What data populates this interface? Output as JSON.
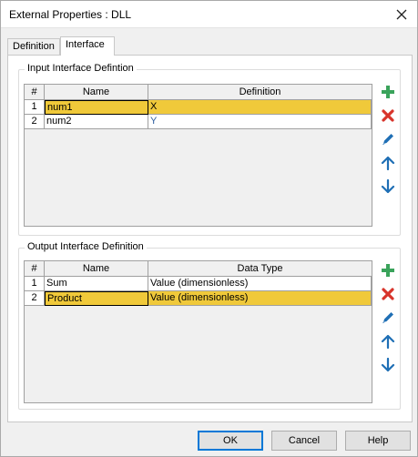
{
  "window": {
    "title": "External Properties : DLL"
  },
  "tabs": [
    {
      "label": "Definition",
      "active": false
    },
    {
      "label": "Interface",
      "active": true
    }
  ],
  "input_group": {
    "title": "Input Interface Defintion",
    "columns": [
      "#",
      "Name",
      "Definition"
    ],
    "rows": [
      {
        "num": "1",
        "name": "num1",
        "value": "X",
        "selected": true
      },
      {
        "num": "2",
        "name": "num2",
        "value": "Y",
        "selected": false
      }
    ]
  },
  "output_group": {
    "title": "Output Interface Definition",
    "columns": [
      "#",
      "Name",
      "Data Type"
    ],
    "rows": [
      {
        "num": "1",
        "name": "Sum",
        "value": "Value (dimensionless)",
        "selected": false
      },
      {
        "num": "2",
        "name": "Product",
        "value": "Value (dimensionless)",
        "selected": true
      }
    ]
  },
  "side_icons": [
    "add-icon",
    "delete-icon",
    "edit-icon",
    "move-up-icon",
    "move-down-icon"
  ],
  "colors": {
    "selection": "#f0c93a",
    "add": "#3aa35b",
    "delete": "#d8342b",
    "arrow": "#1f6fb5"
  },
  "buttons": {
    "ok": "OK",
    "cancel": "Cancel",
    "help": "Help"
  }
}
